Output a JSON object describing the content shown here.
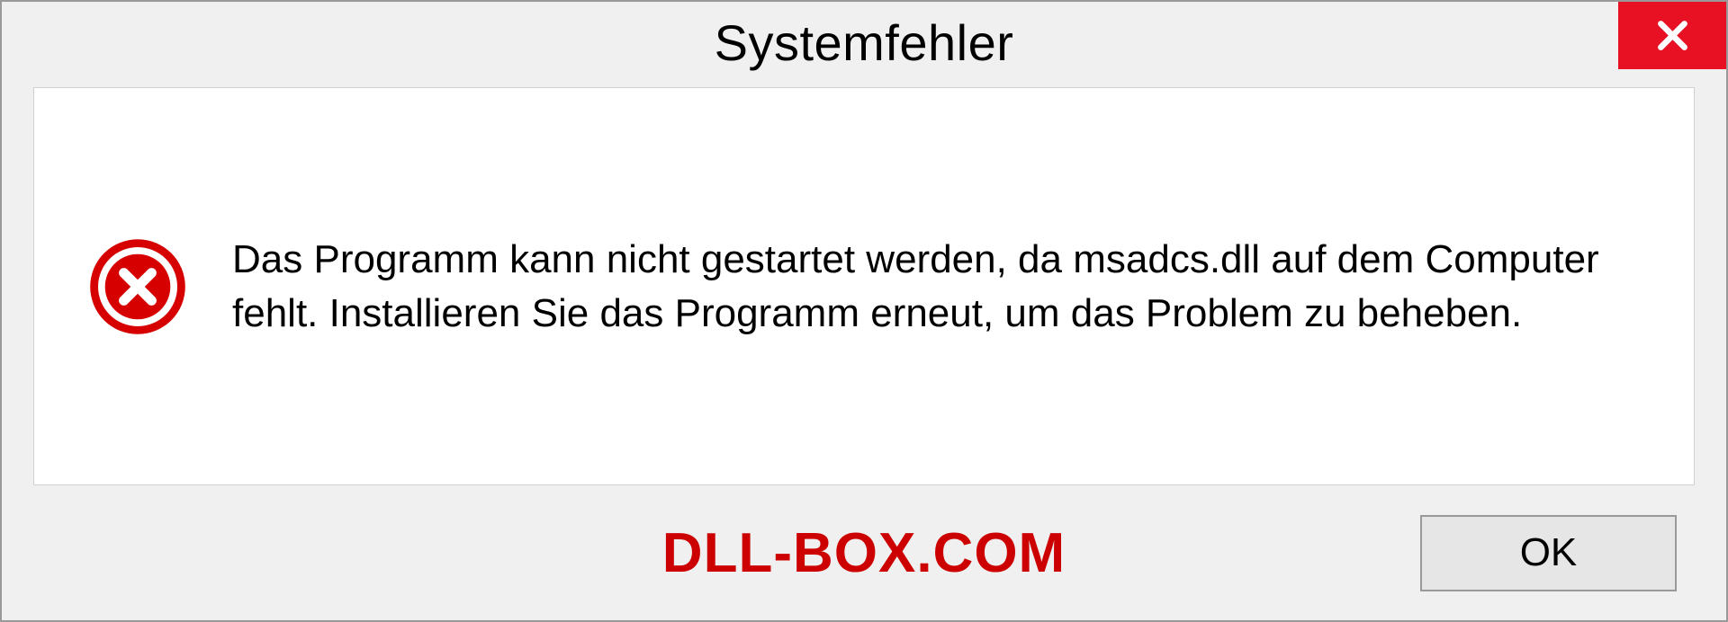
{
  "dialog": {
    "title": "Systemfehler",
    "message": "Das Programm kann nicht gestartet werden, da msadcs.dll auf dem Computer fehlt. Installieren Sie das Programm erneut, um das Problem zu beheben.",
    "ok_label": "OK"
  },
  "watermark": "DLL-BOX.COM"
}
